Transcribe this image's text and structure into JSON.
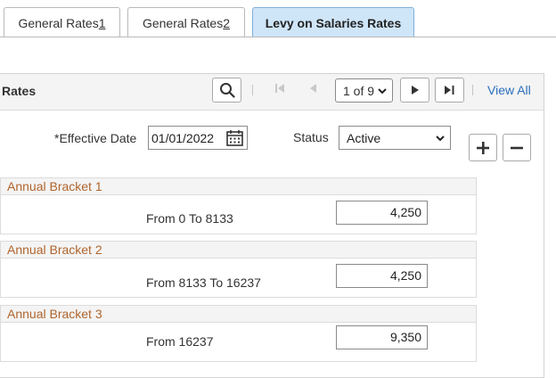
{
  "tabs": [
    {
      "prefix": "General Rates ",
      "hotkey": "1"
    },
    {
      "prefix": "General Rates ",
      "hotkey": "2"
    },
    {
      "label": "Levy on Salaries Rates"
    }
  ],
  "panel": {
    "title": "Rates",
    "pager": "1 of 9",
    "view_all": "View All"
  },
  "form": {
    "effective_date_label": "*Effective Date",
    "effective_date_value": "01/01/2022",
    "status_label": "Status",
    "status_value": "Active"
  },
  "brackets": [
    {
      "title": "Annual Bracket 1",
      "range": "From 0 To 8133",
      "amount": "4,250"
    },
    {
      "title": "Annual Bracket 2",
      "range": "From 8133 To 16237",
      "amount": "4,250"
    },
    {
      "title": "Annual Bracket 3",
      "range": "From 16237",
      "amount": "9,350"
    }
  ],
  "icons": {
    "search": "search-icon",
    "calendar": "calendar-icon",
    "add": "plus-icon",
    "delete": "minus-icon"
  },
  "colors": {
    "active_tab_bg": "#cfe5f8",
    "bracket_title": "#b0652e",
    "link": "#2a6ebb"
  }
}
